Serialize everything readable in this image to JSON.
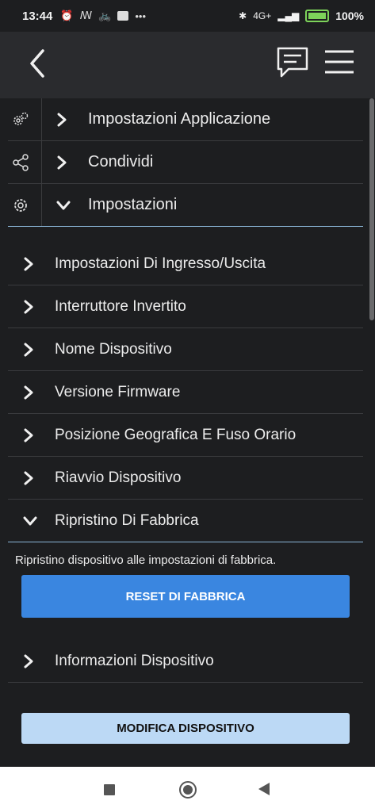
{
  "status_bar": {
    "time": "13:44",
    "notif_icons": [
      "alarm-icon",
      "s-icon",
      "bike-icon",
      "app-icon",
      "more-dots-icon"
    ],
    "network": "4G+",
    "battery_pct": "100%"
  },
  "app_bar": {
    "back_icon": "chevron-left-icon",
    "chat_icon": "chat-icon",
    "menu_icon": "hamburger-menu-icon"
  },
  "top_menu": [
    {
      "label": "Impostazioni Applicazione",
      "icon": "gears-icon",
      "expanded": false
    },
    {
      "label": "Condividi",
      "icon": "share-icon",
      "expanded": false
    },
    {
      "label": "Impostazioni",
      "icon": "gear-icon",
      "expanded": true
    }
  ],
  "settings_items": [
    {
      "label": "Impostazioni Di Ingresso/Uscita",
      "expanded": false
    },
    {
      "label": "Interruttore Invertito",
      "expanded": false
    },
    {
      "label": "Nome Dispositivo",
      "expanded": false
    },
    {
      "label": "Versione Firmware",
      "expanded": false
    },
    {
      "label": "Posizione Geografica E Fuso Orario",
      "expanded": false
    },
    {
      "label": "Riavvio Dispositivo",
      "expanded": false
    },
    {
      "label": "Ripristino Di Fabbrica",
      "expanded": true
    }
  ],
  "factory_reset": {
    "description": "Ripristino dispositivo alle impostazioni di fabbrica.",
    "button_label": "RESET DI FABBRICA"
  },
  "info_item": {
    "label": "Informazioni Dispositivo"
  },
  "edit_button_label": "MODIFICA DISPOSITIVO",
  "colors": {
    "background": "#1d1e20",
    "appbar": "#2a2b2e",
    "accent_blue": "#3a86e0",
    "light_blue": "#bcd9f5",
    "divider_highlight": "#8ab4d6"
  }
}
